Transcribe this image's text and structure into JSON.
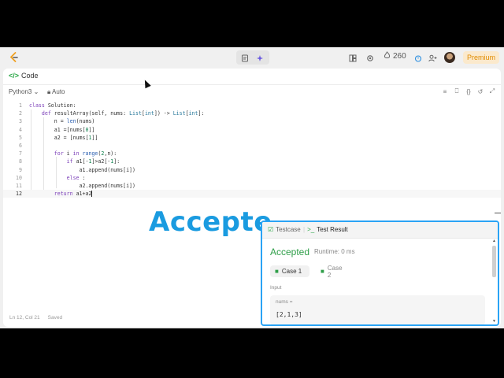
{
  "toolbar": {
    "streak_count": "260",
    "premium_label": "Premium"
  },
  "code_panel": {
    "title": "Code",
    "language": "Python3",
    "mode": "Auto"
  },
  "editor": {
    "lines": [
      {
        "n": "1",
        "parts": [
          [
            "kw",
            "class"
          ],
          [
            "",
            "Solution:"
          ]
        ]
      },
      {
        "n": "2",
        "parts": [
          [
            "",
            "    "
          ],
          [
            "kw",
            "def"
          ],
          [
            "",
            "resultArray(self, nums: "
          ],
          [
            "ty",
            "List"
          ],
          [
            "",
            "["
          ],
          [
            "ty",
            "int"
          ],
          [
            "",
            "]) -> "
          ],
          [
            "ty",
            "List"
          ],
          [
            "",
            "["
          ],
          [
            "ty",
            "int"
          ],
          [
            "",
            "]:"
          ]
        ]
      },
      {
        "n": "3",
        "parts": [
          [
            "",
            "        n = "
          ],
          [
            "fn",
            "len"
          ],
          [
            "",
            "(nums)"
          ]
        ]
      },
      {
        "n": "4",
        "parts": [
          [
            "",
            "        a1 =[nums["
          ],
          [
            "num",
            "0"
          ],
          [
            "",
            "]]"
          ]
        ]
      },
      {
        "n": "5",
        "parts": [
          [
            "",
            "        a2 = [nums["
          ],
          [
            "num",
            "1"
          ],
          [
            "",
            "]]"
          ]
        ]
      },
      {
        "n": "6",
        "parts": [
          [
            "",
            ""
          ]
        ]
      },
      {
        "n": "7",
        "parts": [
          [
            "",
            "        "
          ],
          [
            "kw",
            "for"
          ],
          [
            "",
            "i "
          ],
          [
            "kw",
            "in"
          ],
          [
            "",
            ""
          ],
          [
            "fn",
            "range"
          ],
          [
            "",
            "("
          ],
          [
            "num",
            "2"
          ],
          [
            "",
            ",n):"
          ]
        ]
      },
      {
        "n": "8",
        "parts": [
          [
            "",
            "            "
          ],
          [
            "kw",
            "if"
          ],
          [
            "",
            "a1[-"
          ],
          [
            "num",
            "1"
          ],
          [
            "",
            "]>a2[-"
          ],
          [
            "num",
            "1"
          ],
          [
            "",
            "]:"
          ]
        ]
      },
      {
        "n": "9",
        "parts": [
          [
            "",
            "                a1.append(nums[i])"
          ]
        ]
      },
      {
        "n": "10",
        "parts": [
          [
            "",
            "            "
          ],
          [
            "kw",
            "else"
          ],
          [
            "",
            ":"
          ]
        ]
      },
      {
        "n": "11",
        "parts": [
          [
            "",
            "                a2.append(nums[i])"
          ]
        ]
      },
      {
        "n": "12",
        "parts": [
          [
            "",
            "        "
          ],
          [
            "kw",
            "return"
          ],
          [
            "",
            "a1+a2"
          ]
        ]
      }
    ]
  },
  "status": {
    "position": "Ln 12, Col 21",
    "saved": "Saved"
  },
  "overlay": {
    "caption": "Accepte"
  },
  "result_panel": {
    "tab_testcase": "Testcase",
    "tab_result": "Test Result",
    "verdict": "Accepted",
    "runtime": "Runtime: 0 ms",
    "case1": "Case 1",
    "case2": "Case 2",
    "input_label": "Input",
    "var_name": "nums =",
    "var_value": "[2,1,3]"
  },
  "colors": {
    "accepted_green": "#2e9e48",
    "overlay_blue": "#1a9be0",
    "focus_border": "#2aa3f5",
    "premium_orange": "#e08c00"
  }
}
